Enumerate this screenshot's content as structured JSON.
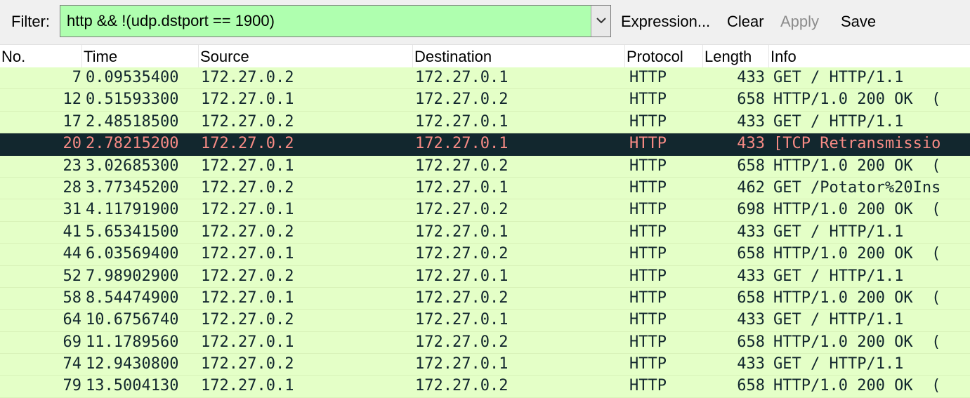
{
  "filter": {
    "label": "Filter:",
    "value": "http && !(udp.dstport == 1900)",
    "valid_color": "#afffaf"
  },
  "toolbar": {
    "expression": "Expression...",
    "clear": "Clear",
    "apply": "Apply",
    "save": "Save"
  },
  "columns": {
    "no": "No.",
    "time": "Time",
    "source": "Source",
    "destination": "Destination",
    "protocol": "Protocol",
    "length": "Length",
    "info": "Info"
  },
  "colors": {
    "row_bg": "#e4ffc7",
    "row_fg": "#12272e",
    "selected_bg": "#12272e",
    "selected_fg": "#f78b85"
  },
  "packets": [
    {
      "no": "7",
      "time": "0.09535400",
      "src": "172.27.0.2",
      "dst": "172.27.0.1",
      "proto": "HTTP",
      "len": "433",
      "info": "GET / HTTP/1.1"
    },
    {
      "no": "12",
      "time": "0.51593300",
      "src": "172.27.0.1",
      "dst": "172.27.0.2",
      "proto": "HTTP",
      "len": "658",
      "info": "HTTP/1.0 200 OK  ("
    },
    {
      "no": "17",
      "time": "2.48518500",
      "src": "172.27.0.2",
      "dst": "172.27.0.1",
      "proto": "HTTP",
      "len": "433",
      "info": "GET / HTTP/1.1"
    },
    {
      "no": "20",
      "time": "2.78215200",
      "src": "172.27.0.2",
      "dst": "172.27.0.1",
      "proto": "HTTP",
      "len": "433",
      "info": "[TCP Retransmissio",
      "selected": true
    },
    {
      "no": "23",
      "time": "3.02685300",
      "src": "172.27.0.1",
      "dst": "172.27.0.2",
      "proto": "HTTP",
      "len": "658",
      "info": "HTTP/1.0 200 OK  ("
    },
    {
      "no": "28",
      "time": "3.77345200",
      "src": "172.27.0.2",
      "dst": "172.27.0.1",
      "proto": "HTTP",
      "len": "462",
      "info": "GET /Potator%20Ins"
    },
    {
      "no": "31",
      "time": "4.11791900",
      "src": "172.27.0.1",
      "dst": "172.27.0.2",
      "proto": "HTTP",
      "len": "698",
      "info": "HTTP/1.0 200 OK  ("
    },
    {
      "no": "41",
      "time": "5.65341500",
      "src": "172.27.0.2",
      "dst": "172.27.0.1",
      "proto": "HTTP",
      "len": "433",
      "info": "GET / HTTP/1.1"
    },
    {
      "no": "44",
      "time": "6.03569400",
      "src": "172.27.0.1",
      "dst": "172.27.0.2",
      "proto": "HTTP",
      "len": "658",
      "info": "HTTP/1.0 200 OK  ("
    },
    {
      "no": "52",
      "time": "7.98902900",
      "src": "172.27.0.2",
      "dst": "172.27.0.1",
      "proto": "HTTP",
      "len": "433",
      "info": "GET / HTTP/1.1"
    },
    {
      "no": "58",
      "time": "8.54474900",
      "src": "172.27.0.1",
      "dst": "172.27.0.2",
      "proto": "HTTP",
      "len": "658",
      "info": "HTTP/1.0 200 OK  ("
    },
    {
      "no": "64",
      "time": "10.6756740",
      "src": "172.27.0.2",
      "dst": "172.27.0.1",
      "proto": "HTTP",
      "len": "433",
      "info": "GET / HTTP/1.1"
    },
    {
      "no": "69",
      "time": "11.1789560",
      "src": "172.27.0.1",
      "dst": "172.27.0.2",
      "proto": "HTTP",
      "len": "658",
      "info": "HTTP/1.0 200 OK  ("
    },
    {
      "no": "74",
      "time": "12.9430800",
      "src": "172.27.0.2",
      "dst": "172.27.0.1",
      "proto": "HTTP",
      "len": "433",
      "info": "GET / HTTP/1.1"
    },
    {
      "no": "79",
      "time": "13.5004130",
      "src": "172.27.0.1",
      "dst": "172.27.0.2",
      "proto": "HTTP",
      "len": "658",
      "info": "HTTP/1.0 200 OK  ("
    }
  ]
}
